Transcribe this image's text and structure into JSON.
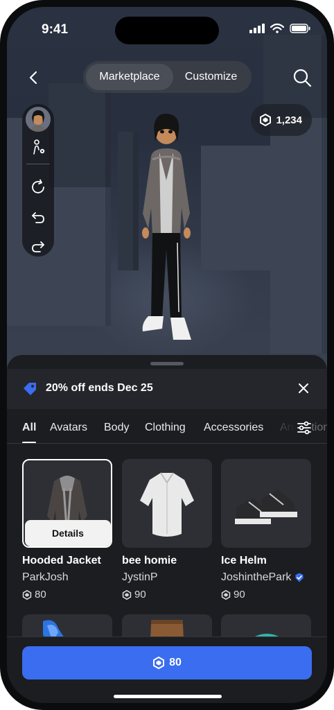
{
  "status": {
    "time": "9:41"
  },
  "nav": {
    "tabs": [
      {
        "label": "Marketplace",
        "active": true
      },
      {
        "label": "Customize",
        "active": false
      }
    ]
  },
  "balance": {
    "amount": "1,234",
    "icon": "robux-icon"
  },
  "promo": {
    "text": "20% off ends Dec 25",
    "icon": "tag-icon"
  },
  "categories": [
    "All",
    "Avatars",
    "Body",
    "Clothing",
    "Accessories",
    "Animations"
  ],
  "items": [
    {
      "name": "Hooded Jacket",
      "creator": "ParkJosh",
      "price": "80",
      "verified": false,
      "selected": true,
      "action": "Details"
    },
    {
      "name": "bee homie",
      "creator": "JystinP",
      "price": "90",
      "verified": false,
      "selected": false
    },
    {
      "name": "Ice Helm",
      "creator": "JoshinthePark",
      "price": "90",
      "verified": true,
      "selected": false
    }
  ],
  "buy": {
    "price": "80"
  },
  "colors": {
    "accent": "#3a6df0",
    "sheet": "#1b1d21",
    "card": "#2d2f34"
  }
}
